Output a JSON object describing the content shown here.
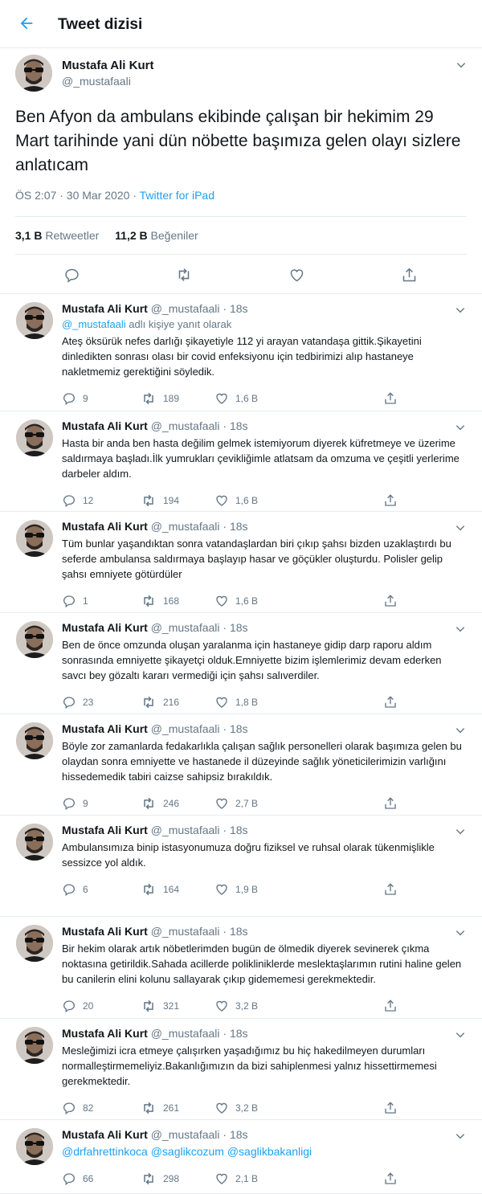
{
  "header": {
    "title": "Tweet dizisi"
  },
  "main_tweet": {
    "name": "Mustafa Ali Kurt",
    "handle": "@_mustafaali",
    "text": "Ben Afyon da ambulans ekibinde çalışan bir hekimim 29 Mart tarihinde yani dün nöbette başımıza gelen olayı sizlere anlatıcam",
    "timestamp": "ÖS 2:07 · 30 Mar 2020 · ",
    "source": "Twitter for iPad",
    "retweets_count": "3,1 B",
    "retweets_label": "Retweetler",
    "likes_count": "11,2 B",
    "likes_label": "Beğeniler"
  },
  "replies": [
    {
      "name": "Mustafa Ali Kurt",
      "handle": "@_mustafaali",
      "time": "· 18s",
      "replying_mention": "@_mustafaali",
      "replying_suffix": " adlı kişiye yanıt olarak",
      "text": "Ateş öksürük nefes darlığı şikayetiyle 112 yi arayan vatandaşa gittik.Şikayetini dinledikten sonrası olası bir covid enfeksiyonu için tedbirimizi alıp hastaneye nakletmemiz gerektiğini söyledik.",
      "replies": "9",
      "retweets": "189",
      "likes": "1,6 B"
    },
    {
      "name": "Mustafa Ali Kurt",
      "handle": "@_mustafaali",
      "time": "· 18s",
      "text": "Hasta bir anda ben hasta değilim gelmek istemiyorum diyerek küfretmeye ve üzerime saldırmaya başladı.İlk yumrukları çevikliğimle atlatsam da omzuma ve çeşitli yerlerime darbeler aldım.",
      "replies": "12",
      "retweets": "194",
      "likes": "1,6 B"
    },
    {
      "name": "Mustafa Ali Kurt",
      "handle": "@_mustafaali",
      "time": "· 18s",
      "text": "Tüm bunlar yaşandıktan sonra vatandaşlardan biri çıkıp şahsı bizden uzaklaştırdı bu seferde ambulansa saldırmaya başlayıp hasar ve göçükler oluşturdu. Polisler gelip şahsı emniyete götürdüler",
      "replies": "1",
      "retweets": "168",
      "likes": "1,6 B"
    },
    {
      "name": "Mustafa Ali Kurt",
      "handle": "@_mustafaali",
      "time": "· 18s",
      "text": "Ben de önce omzunda oluşan yaralanma için hastaneye gidip  darp raporu aldım sonrasında emniyette şikayetçi olduk.Emniyette bizim işlemlerimiz devam ederken savcı bey gözaltı kararı vermediği için şahsı salıverdiler.",
      "replies": "23",
      "retweets": "216",
      "likes": "1,8 B"
    },
    {
      "name": "Mustafa Ali Kurt",
      "handle": "@_mustafaali",
      "time": "· 18s",
      "text": "Böyle zor zamanlarda fedakarlıkla çalışan sağlık personelleri olarak başımıza gelen bu olaydan sonra emniyette ve hastanede il düzeyinde sağlık yöneticilerimizin varlığını hissedemedik tabiri caizse sahipsiz bırakıldık.",
      "replies": "9",
      "retweets": "246",
      "likes": "2,7 B"
    },
    {
      "name": "Mustafa Ali Kurt",
      "handle": "@_mustafaali",
      "time": "· 18s",
      "text": "Ambulansımıza binip istasyonumuza doğru fiziksel ve ruhsal olarak tükenmişlikle sessizce yol aldık.",
      "replies": "6",
      "retweets": "164",
      "likes": "1,9 B"
    },
    {
      "name": "Mustafa Ali Kurt",
      "handle": "@_mustafaali",
      "time": "· 18s",
      "text": "Bir hekim olarak artık nöbetlerimden bugün de ölmedik diyerek sevinerek çıkma noktasına getirildik.Sahada acillerde polikliniklerde meslektaşlarımın rutini haline gelen bu canilerin elini kolunu sallayarak çıkıp gidememesi gerekmektedir.",
      "replies": "20",
      "retweets": "321",
      "likes": "3,2 B"
    },
    {
      "name": "Mustafa Ali Kurt",
      "handle": "@_mustafaali",
      "time": "· 18s",
      "text": "Mesleğimizi icra etmeye çalışırken yaşadığımız bu hiç hakedilmeyen durumları normalleştirmemeliyiz.Bakanlığımızın da bizi sahiplenmesi yalnız hissettirmemesi gerekmektedir.",
      "replies": "82",
      "retweets": "261",
      "likes": "3,2 B"
    },
    {
      "name": "Mustafa Ali Kurt",
      "handle": "@_mustafaali",
      "time": "· 18s",
      "text": "@drfahrettinkoca @saglikcozum @saglikbakanligi",
      "mentions_only": true,
      "replies": "66",
      "retweets": "298",
      "likes": "2,1 B"
    }
  ],
  "colors": {
    "accent": "#1da1f2",
    "secondary_text": "#657786",
    "divider": "#e6ecf0"
  },
  "icons": {
    "back": "arrow-left-icon",
    "caret": "chevron-down-icon",
    "reply": "speech-bubble-icon",
    "retweet": "retweet-icon",
    "like": "heart-icon",
    "share": "share-icon"
  }
}
